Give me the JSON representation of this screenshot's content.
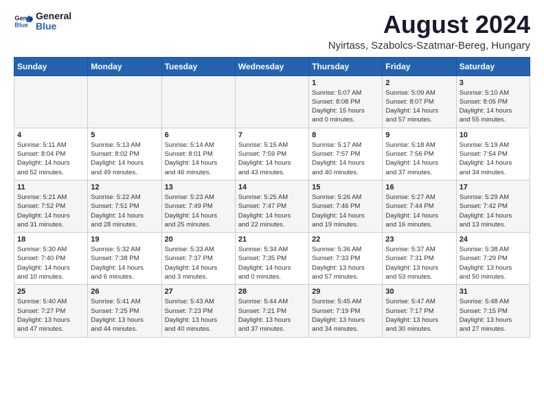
{
  "header": {
    "logo_line1": "General",
    "logo_line2": "Blue",
    "month": "August 2024",
    "location": "Nyirtass, Szabolcs-Szatmar-Bereg, Hungary"
  },
  "weekdays": [
    "Sunday",
    "Monday",
    "Tuesday",
    "Wednesday",
    "Thursday",
    "Friday",
    "Saturday"
  ],
  "weeks": [
    [
      {
        "day": "",
        "detail": ""
      },
      {
        "day": "",
        "detail": ""
      },
      {
        "day": "",
        "detail": ""
      },
      {
        "day": "",
        "detail": ""
      },
      {
        "day": "1",
        "detail": "Sunrise: 5:07 AM\nSunset: 8:08 PM\nDaylight: 15 hours\nand 0 minutes."
      },
      {
        "day": "2",
        "detail": "Sunrise: 5:09 AM\nSunset: 8:07 PM\nDaylight: 14 hours\nand 57 minutes."
      },
      {
        "day": "3",
        "detail": "Sunrise: 5:10 AM\nSunset: 8:05 PM\nDaylight: 14 hours\nand 55 minutes."
      }
    ],
    [
      {
        "day": "4",
        "detail": "Sunrise: 5:11 AM\nSunset: 8:04 PM\nDaylight: 14 hours\nand 52 minutes."
      },
      {
        "day": "5",
        "detail": "Sunrise: 5:13 AM\nSunset: 8:02 PM\nDaylight: 14 hours\nand 49 minutes."
      },
      {
        "day": "6",
        "detail": "Sunrise: 5:14 AM\nSunset: 8:01 PM\nDaylight: 14 hours\nand 46 minutes."
      },
      {
        "day": "7",
        "detail": "Sunrise: 5:15 AM\nSunset: 7:59 PM\nDaylight: 14 hours\nand 43 minutes."
      },
      {
        "day": "8",
        "detail": "Sunrise: 5:17 AM\nSunset: 7:57 PM\nDaylight: 14 hours\nand 40 minutes."
      },
      {
        "day": "9",
        "detail": "Sunrise: 5:18 AM\nSunset: 7:56 PM\nDaylight: 14 hours\nand 37 minutes."
      },
      {
        "day": "10",
        "detail": "Sunrise: 5:19 AM\nSunset: 7:54 PM\nDaylight: 14 hours\nand 34 minutes."
      }
    ],
    [
      {
        "day": "11",
        "detail": "Sunrise: 5:21 AM\nSunset: 7:52 PM\nDaylight: 14 hours\nand 31 minutes."
      },
      {
        "day": "12",
        "detail": "Sunrise: 5:22 AM\nSunset: 7:51 PM\nDaylight: 14 hours\nand 28 minutes."
      },
      {
        "day": "13",
        "detail": "Sunrise: 5:23 AM\nSunset: 7:49 PM\nDaylight: 14 hours\nand 25 minutes."
      },
      {
        "day": "14",
        "detail": "Sunrise: 5:25 AM\nSunset: 7:47 PM\nDaylight: 14 hours\nand 22 minutes."
      },
      {
        "day": "15",
        "detail": "Sunrise: 5:26 AM\nSunset: 7:46 PM\nDaylight: 14 hours\nand 19 minutes."
      },
      {
        "day": "16",
        "detail": "Sunrise: 5:27 AM\nSunset: 7:44 PM\nDaylight: 14 hours\nand 16 minutes."
      },
      {
        "day": "17",
        "detail": "Sunrise: 5:29 AM\nSunset: 7:42 PM\nDaylight: 14 hours\nand 13 minutes."
      }
    ],
    [
      {
        "day": "18",
        "detail": "Sunrise: 5:30 AM\nSunset: 7:40 PM\nDaylight: 14 hours\nand 10 minutes."
      },
      {
        "day": "19",
        "detail": "Sunrise: 5:32 AM\nSunset: 7:38 PM\nDaylight: 14 hours\nand 6 minutes."
      },
      {
        "day": "20",
        "detail": "Sunrise: 5:33 AM\nSunset: 7:37 PM\nDaylight: 14 hours\nand 3 minutes."
      },
      {
        "day": "21",
        "detail": "Sunrise: 5:34 AM\nSunset: 7:35 PM\nDaylight: 14 hours\nand 0 minutes."
      },
      {
        "day": "22",
        "detail": "Sunrise: 5:36 AM\nSunset: 7:33 PM\nDaylight: 13 hours\nand 57 minutes."
      },
      {
        "day": "23",
        "detail": "Sunrise: 5:37 AM\nSunset: 7:31 PM\nDaylight: 13 hours\nand 53 minutes."
      },
      {
        "day": "24",
        "detail": "Sunrise: 5:38 AM\nSunset: 7:29 PM\nDaylight: 13 hours\nand 50 minutes."
      }
    ],
    [
      {
        "day": "25",
        "detail": "Sunrise: 5:40 AM\nSunset: 7:27 PM\nDaylight: 13 hours\nand 47 minutes."
      },
      {
        "day": "26",
        "detail": "Sunrise: 5:41 AM\nSunset: 7:25 PM\nDaylight: 13 hours\nand 44 minutes."
      },
      {
        "day": "27",
        "detail": "Sunrise: 5:43 AM\nSunset: 7:23 PM\nDaylight: 13 hours\nand 40 minutes."
      },
      {
        "day": "28",
        "detail": "Sunrise: 5:44 AM\nSunset: 7:21 PM\nDaylight: 13 hours\nand 37 minutes."
      },
      {
        "day": "29",
        "detail": "Sunrise: 5:45 AM\nSunset: 7:19 PM\nDaylight: 13 hours\nand 34 minutes."
      },
      {
        "day": "30",
        "detail": "Sunrise: 5:47 AM\nSunset: 7:17 PM\nDaylight: 13 hours\nand 30 minutes."
      },
      {
        "day": "31",
        "detail": "Sunrise: 5:48 AM\nSunset: 7:15 PM\nDaylight: 13 hours\nand 27 minutes."
      }
    ]
  ]
}
